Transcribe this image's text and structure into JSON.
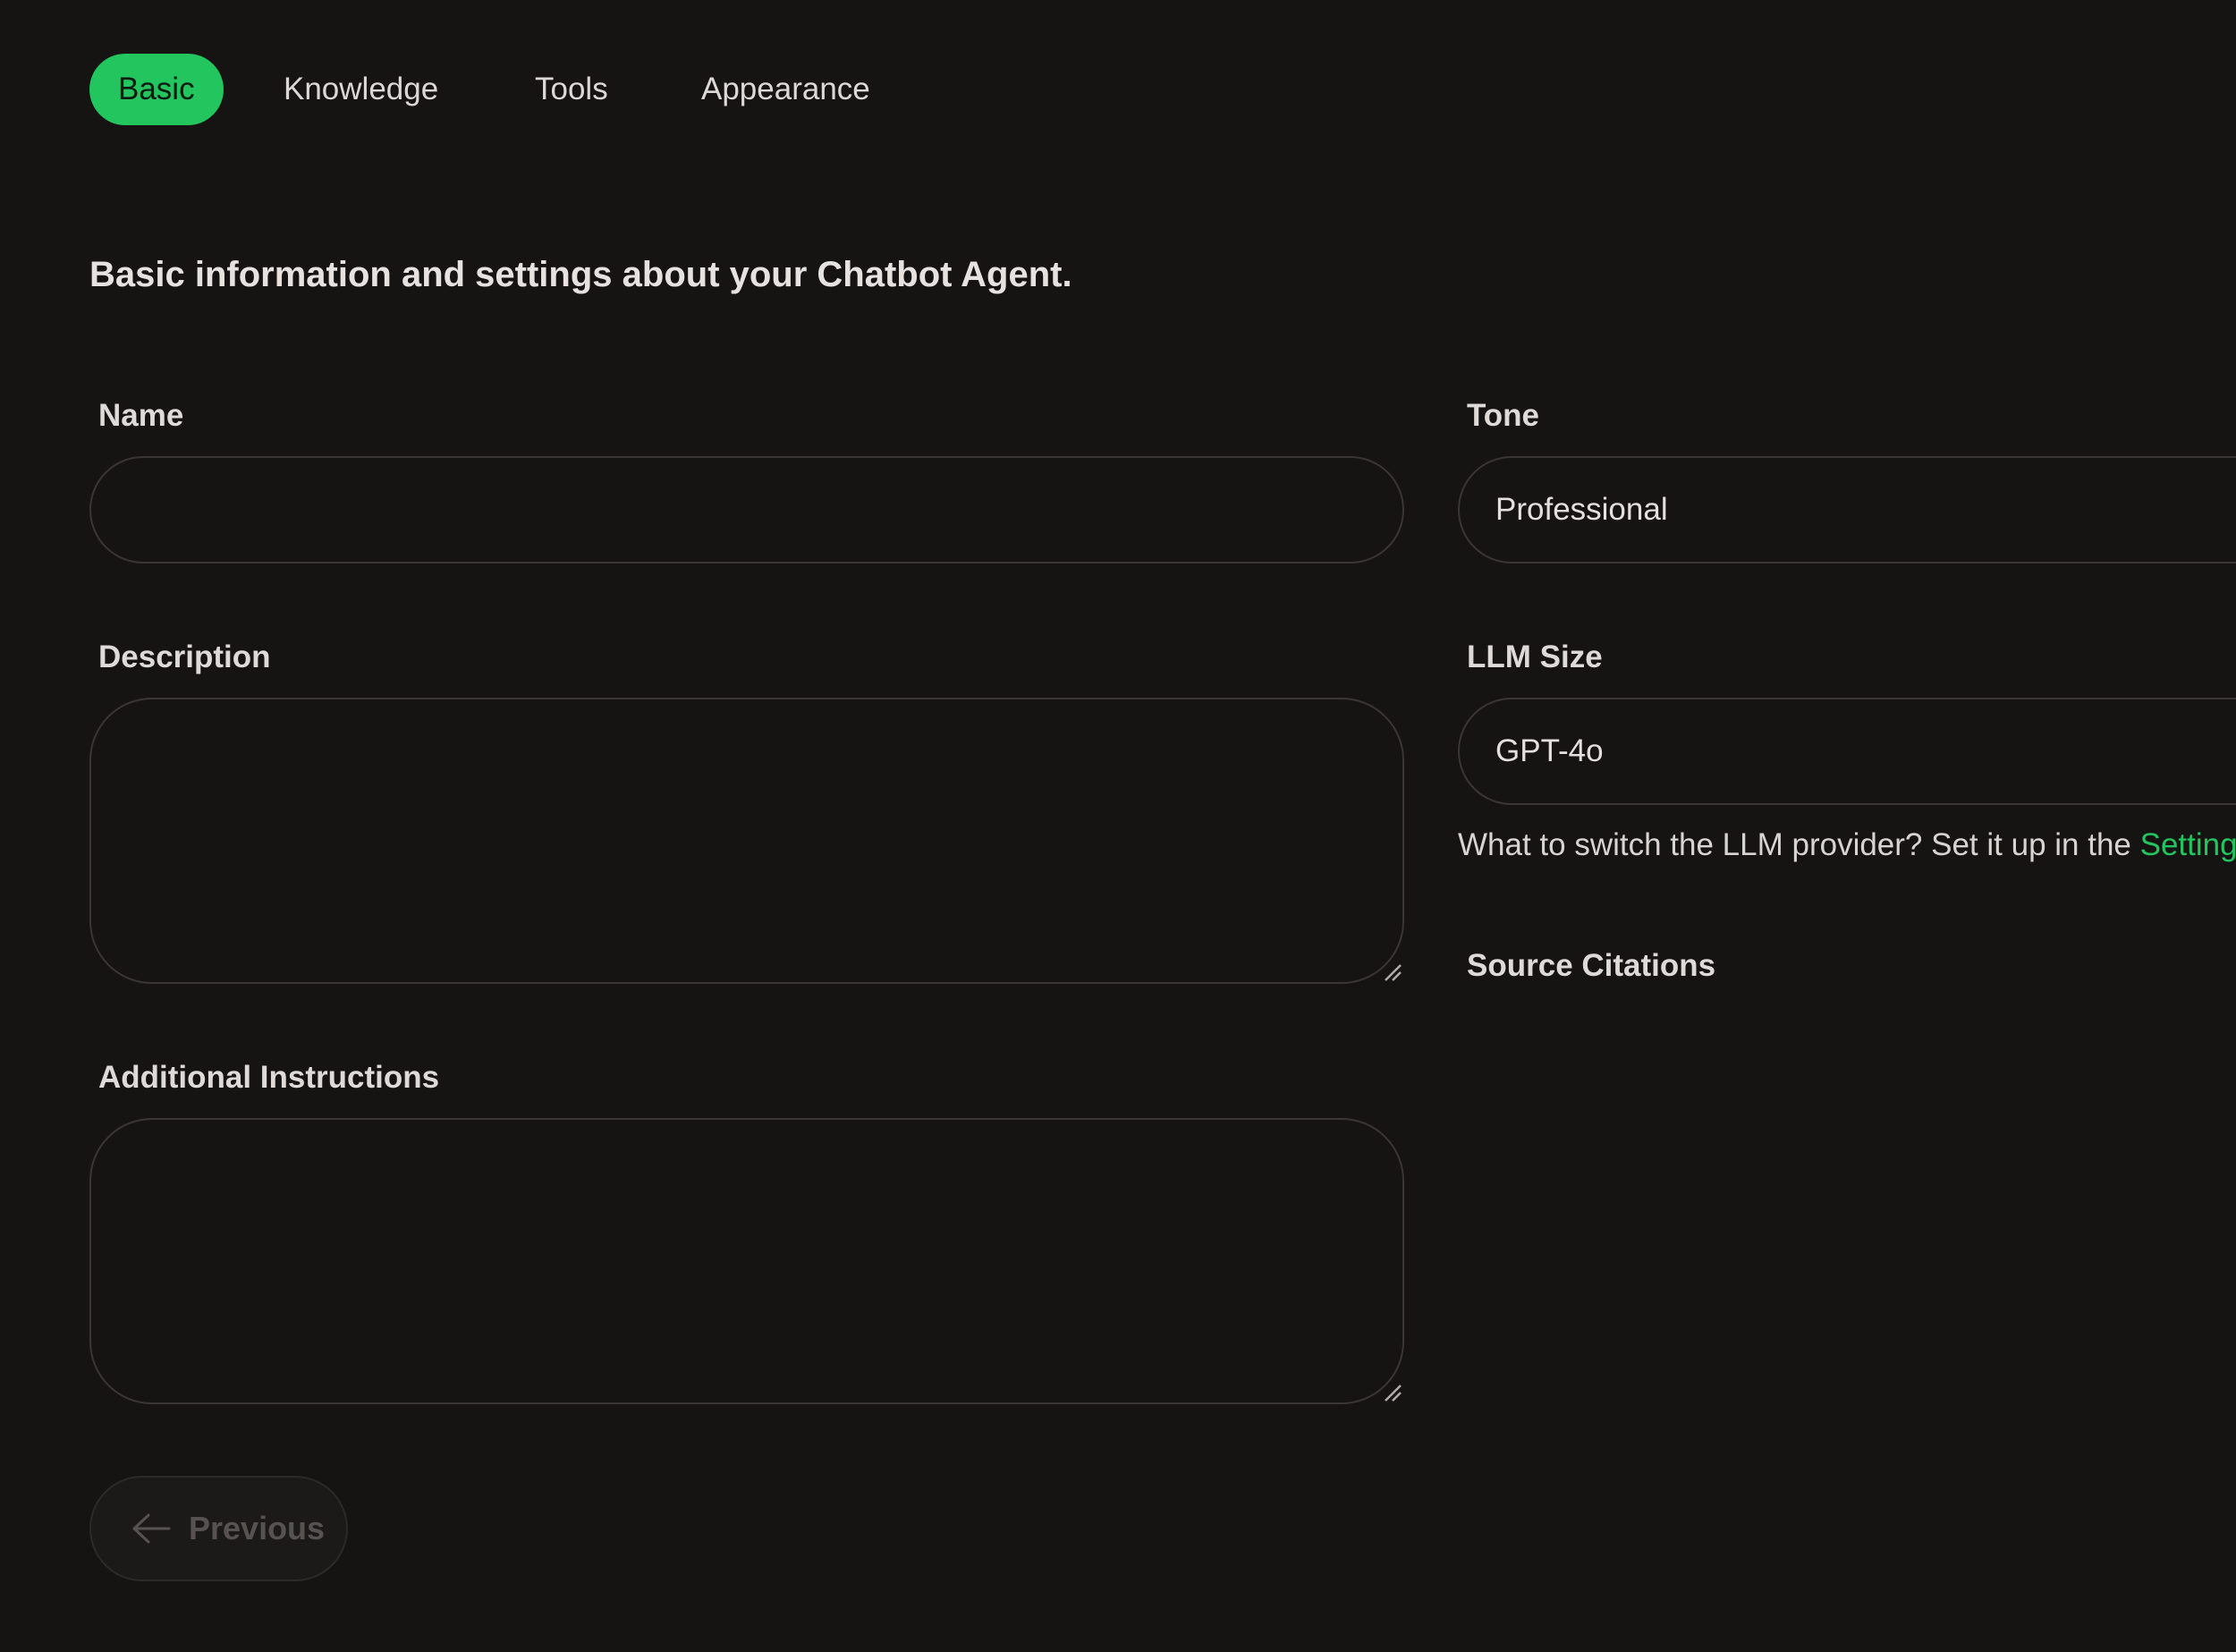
{
  "tabs": [
    {
      "label": "Basic",
      "active": true
    },
    {
      "label": "Knowledge",
      "active": false
    },
    {
      "label": "Tools",
      "active": false
    },
    {
      "label": "Appearance",
      "active": false
    }
  ],
  "section": {
    "description": "Basic information and settings about your Chatbot Agent."
  },
  "form": {
    "name": {
      "label": "Name",
      "value": ""
    },
    "description": {
      "label": "Description",
      "value": ""
    },
    "additional_instructions": {
      "label": "Additional Instructions",
      "value": ""
    },
    "tone": {
      "label": "Tone",
      "value": "Professional"
    },
    "llm_size": {
      "label": "LLM Size",
      "value": "GPT-4o"
    },
    "llm_helper": {
      "text": "What to switch the LLM provider? Set it up in the ",
      "link_text": "Setting"
    },
    "source_citations": {
      "label": "Source Citations"
    }
  },
  "buttons": {
    "previous": {
      "label": "Previous",
      "disabled": true
    }
  },
  "colors": {
    "accent": "#22c55e",
    "background": "#161313",
    "border": "#3a3634"
  }
}
